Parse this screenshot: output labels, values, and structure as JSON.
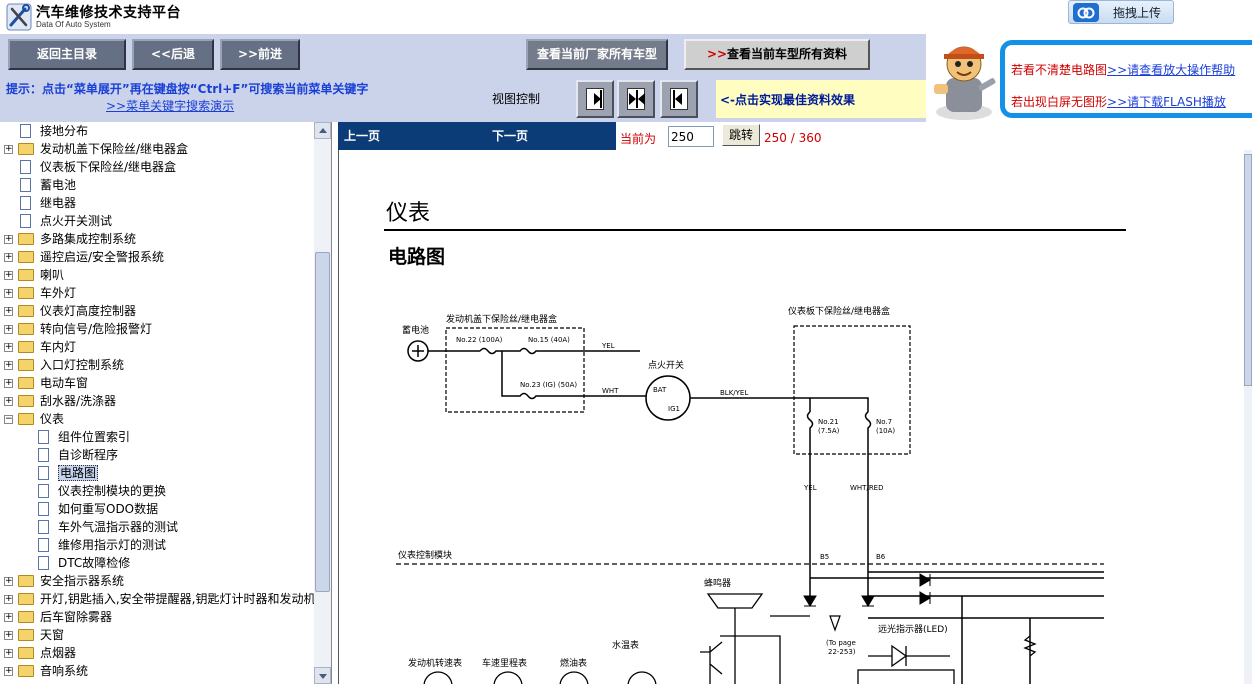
{
  "app": {
    "title": "汽车维修技术支持平台",
    "subtitle": "Data Of Auto System",
    "upload_label": "拖拽上传"
  },
  "nav": {
    "home": "返回主目录",
    "back": "<<后退",
    "forward": ">>前进",
    "all_models": "查看当前厂家所有车型",
    "all_docs_arrows": ">>",
    "all_docs": "查看当前车型所有资料"
  },
  "hint": {
    "text": "提示：点击“菜单展开”再在键盘按“Ctrl+F”可搜索当前菜单关键字",
    "link": ">>菜单关键字搜索演示"
  },
  "view": {
    "label": "视图控制",
    "tip": "<-点击实现最佳资料效果"
  },
  "help": {
    "line1_text": "若看不清楚电路图",
    "line1_link": ">>请查看放大操作帮助",
    "line2_text": "若出现白屏无图形",
    "line2_link": ">>请下载FLASH播放"
  },
  "tree": {
    "items": [
      {
        "label": "接地分布",
        "type": "doc",
        "level": 0
      },
      {
        "label": "发动机盖下保险丝/继电器盒",
        "type": "folder",
        "level": 0
      },
      {
        "label": "仪表板下保险丝/继电器盒",
        "type": "doc",
        "level": 0
      },
      {
        "label": "蓄电池",
        "type": "doc",
        "level": 0
      },
      {
        "label": "继电器",
        "type": "doc",
        "level": 0
      },
      {
        "label": "点火开关测试",
        "type": "doc",
        "level": 0
      },
      {
        "label": "多路集成控制系统",
        "type": "folder",
        "level": 0
      },
      {
        "label": "遥控启运/安全警报系统",
        "type": "folder",
        "level": 0
      },
      {
        "label": "喇叭",
        "type": "folder",
        "level": 0
      },
      {
        "label": "车外灯",
        "type": "folder",
        "level": 0
      },
      {
        "label": "仪表灯高度控制器",
        "type": "folder",
        "level": 0
      },
      {
        "label": "转向信号/危险报警灯",
        "type": "folder",
        "level": 0
      },
      {
        "label": "车内灯",
        "type": "folder",
        "level": 0
      },
      {
        "label": "入口灯控制系统",
        "type": "folder",
        "level": 0
      },
      {
        "label": "电动车窗",
        "type": "folder",
        "level": 0
      },
      {
        "label": "刮水器/洗涤器",
        "type": "folder",
        "level": 0
      },
      {
        "label": "仪表",
        "type": "folder-open",
        "level": 0
      },
      {
        "label": "组件位置索引",
        "type": "doc",
        "level": 1
      },
      {
        "label": "自诊断程序",
        "type": "doc",
        "level": 1
      },
      {
        "label": "电路图",
        "type": "doc",
        "level": 1,
        "selected": true
      },
      {
        "label": "仪表控制模块的更换",
        "type": "doc",
        "level": 1
      },
      {
        "label": "如何重写ODO数据",
        "type": "doc",
        "level": 1
      },
      {
        "label": "车外气温指示器的测试",
        "type": "doc",
        "level": 1
      },
      {
        "label": "维修用指示灯的测试",
        "type": "doc",
        "level": 1
      },
      {
        "label": "DTC故障检修",
        "type": "doc",
        "level": 1
      },
      {
        "label": "安全指示器系统",
        "type": "folder",
        "level": 0
      },
      {
        "label": "开灯,钥匙插入,安全带提醒器,钥匙灯计时器和发动机",
        "type": "folder",
        "level": 0
      },
      {
        "label": "后车窗除雾器",
        "type": "folder",
        "level": 0
      },
      {
        "label": "天窗",
        "type": "folder",
        "level": 0
      },
      {
        "label": "点烟器",
        "type": "folder",
        "level": 0
      },
      {
        "label": "音响系统",
        "type": "folder",
        "level": 0
      }
    ]
  },
  "pager": {
    "prev": "上一页",
    "next": "下一页",
    "current_label": "当前为",
    "current_value": "250",
    "jump": "跳转",
    "count": "250 / 360"
  },
  "document": {
    "title": "仪表",
    "subtitle": "电路图",
    "diagram": {
      "battery": "蓄电池",
      "underhood_box": "发动机盖下保险丝/继电器盒",
      "dash_box": "仪表板下保险丝/继电器盒",
      "fuse22": "No.22 (100A)",
      "fuse15": "No.15 (40A)",
      "fuse23": "No.23 (IG) (50A)",
      "ign_switch": "点火开关",
      "bat": "BAT",
      "ig1": "IG1",
      "wire_yel": "YEL",
      "wire_wht": "WHT",
      "wire_blkyel": "BLK/YEL",
      "fuse21": "No.21",
      "fuse21_amp": "(7.5A)",
      "fuse7": "No.7",
      "fuse7_amp": "(10A)",
      "wire_yel2": "YEL",
      "wire_whtred": "WHT/RED",
      "module": "仪表控制模块",
      "pin_b5": "B5",
      "pin_b6": "B6",
      "buzzer": "蜂鸣器",
      "high_beam": "远光指示器(LED)",
      "to_page": "(To page",
      "to_page_num": "22-253)",
      "tach": "发动机转速表",
      "speedo": "车速里程表",
      "fuel": "燃油表",
      "temp": "水温表"
    }
  }
}
